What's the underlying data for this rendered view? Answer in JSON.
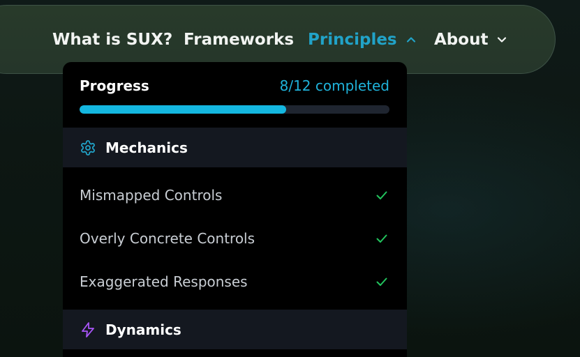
{
  "nav": {
    "items": [
      {
        "label": "What is SUX?"
      },
      {
        "label": "Frameworks"
      },
      {
        "label": "Principles"
      },
      {
        "label": "About"
      }
    ]
  },
  "dropdown": {
    "progress": {
      "label": "Progress",
      "count_text": "8/12 completed",
      "completed": 8,
      "total": 12
    },
    "sections": [
      {
        "title": "Mechanics",
        "icon": "gear-icon",
        "items": [
          {
            "label": "Mismapped Controls",
            "completed": true
          },
          {
            "label": "Overly Concrete Controls",
            "completed": true
          },
          {
            "label": "Exaggerated Responses",
            "completed": true
          }
        ]
      },
      {
        "title": "Dynamics",
        "icon": "lightning-icon",
        "items": []
      }
    ]
  },
  "colors": {
    "accent": "#21a3c8",
    "progress_fill": "#14b7e0",
    "check": "#22c55e",
    "dynamics_icon": "#a855f7"
  }
}
